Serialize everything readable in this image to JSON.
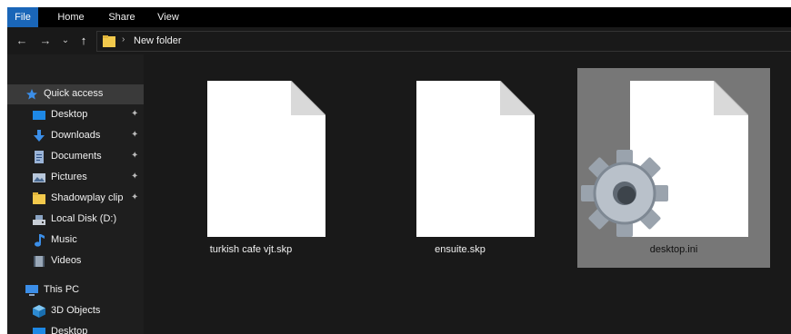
{
  "ribbon": {
    "tabs": [
      {
        "label": "File"
      },
      {
        "label": "Home"
      },
      {
        "label": "Share"
      },
      {
        "label": "View"
      }
    ]
  },
  "nav": {
    "back": "←",
    "forward": "→",
    "recent": "⌄",
    "up": "↑"
  },
  "address": {
    "separator": "›",
    "crumb": "New folder"
  },
  "sidebar": {
    "items": [
      {
        "label": "Quick access",
        "icon": "star-icon"
      },
      {
        "label": "Desktop",
        "icon": "desktop-icon",
        "pinned": "✦"
      },
      {
        "label": "Downloads",
        "icon": "download-icon",
        "pinned": "✦"
      },
      {
        "label": "Documents",
        "icon": "documents-icon",
        "pinned": "✦"
      },
      {
        "label": "Pictures",
        "icon": "pictures-icon",
        "pinned": "✦"
      },
      {
        "label": "Shadowplay clip",
        "icon": "folder-icon",
        "pinned": "✦"
      },
      {
        "label": "Local Disk (D:)",
        "icon": "drive-icon"
      },
      {
        "label": "Music",
        "icon": "music-icon"
      },
      {
        "label": "Videos",
        "icon": "videos-icon"
      },
      {
        "label": "This PC",
        "icon": "pc-icon"
      },
      {
        "label": "3D Objects",
        "icon": "cube-icon"
      },
      {
        "label": "Desktop",
        "icon": "desktop-icon"
      }
    ]
  },
  "files": [
    {
      "name": "turkish cafe vjt.skp",
      "icon": "blank-file-icon"
    },
    {
      "name": "ensuite.skp",
      "icon": "blank-file-icon"
    },
    {
      "name": "desktop.ini",
      "icon": "settings-file-icon"
    }
  ],
  "colors": {
    "accent": "#1a66b8",
    "background": "#191919",
    "sidebar": "#1e1e1e",
    "selected_tile": "#777777"
  }
}
